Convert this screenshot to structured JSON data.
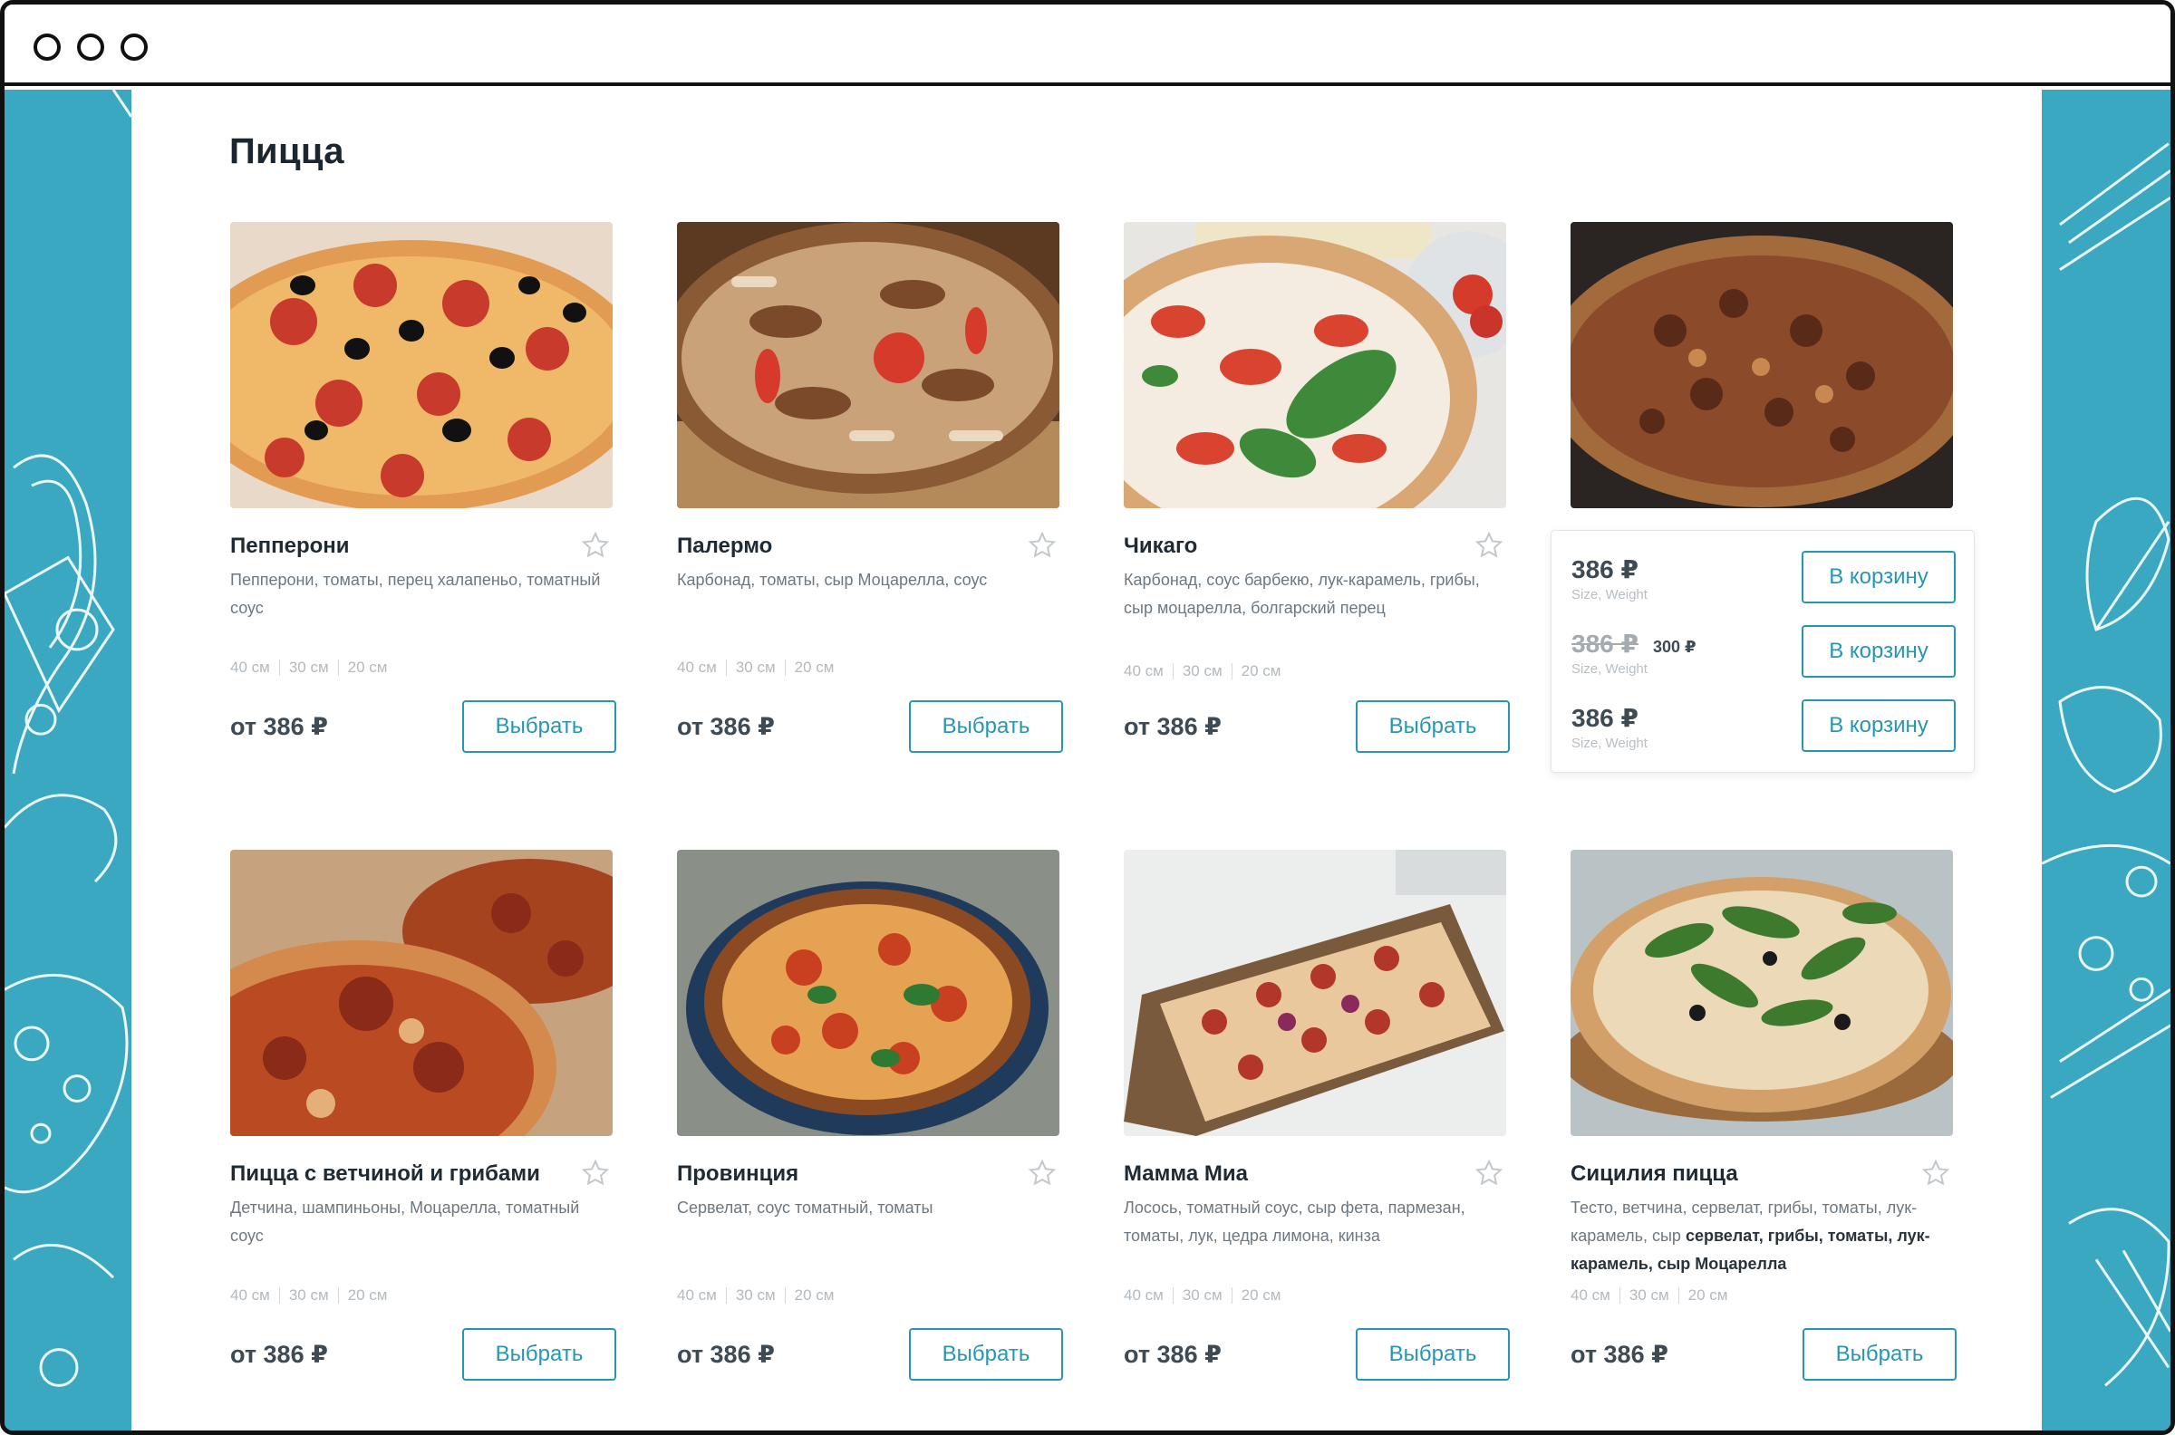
{
  "page": {
    "title": "Пицца"
  },
  "colors": {
    "accent": "#2697b2",
    "side_panel": "#3aa8c1",
    "text": "#1f2a33"
  },
  "products": [
    {
      "name": "Пепперони",
      "description": "Пепперони, томаты, перец халапеньо, томатный соус",
      "sizes": [
        "40 см",
        "30 см",
        "20 см"
      ],
      "price": "от 386 ₽",
      "button": "Выбрать"
    },
    {
      "name": "Палермо",
      "description": "Карбонад, томаты, сыр Моцарелла, соус",
      "sizes": [
        "40 см",
        "30 см",
        "20 см"
      ],
      "price": "от 386 ₽",
      "button": "Выбрать"
    },
    {
      "name": "Чикаго",
      "description": "Карбонад, соус барбекю, лук-карамель, грибы, сыр моцарелла, болгарский перец",
      "sizes": [
        "40 см",
        "30 см",
        "20 см"
      ],
      "price": "от 386 ₽",
      "button": "Выбрать"
    },
    {
      "name": "Пицца с ветчиной и грибами",
      "description": "Детчина, шампиньоны, Моцарелла, томатный соус",
      "sizes": [
        "40 см",
        "30 см",
        "20 см"
      ],
      "price": "от 386 ₽",
      "button": "Выбрать"
    },
    {
      "name": "Провинция",
      "description": "Сервелат, соус томатный, томаты",
      "sizes": [
        "40 см",
        "30 см",
        "20 см"
      ],
      "price": "от 386 ₽",
      "button": "Выбрать"
    },
    {
      "name": "Мамма Миа",
      "description": "Лосось, томатный соус, сыр фета, пармезан, томаты, лук, цедра лимона, кинза",
      "sizes": [
        "40 см",
        "30 см",
        "20 см"
      ],
      "price": "от 386 ₽",
      "button": "Выбрать"
    },
    {
      "name": "Сицилия пицца",
      "description_plain": "Тесто, ветчина, сервелат, грибы, томаты, лук-карамель, сыр ",
      "description_bold": "сервелат, грибы, томаты, лук-карамель, сыр Моцарелла",
      "sizes": [
        "40 см",
        "30 см",
        "20 см"
      ],
      "price": "от 386 ₽",
      "button": "Выбрать"
    }
  ],
  "popover": {
    "options": [
      {
        "price": "386 ₽",
        "sub": "Size, Weight",
        "button": "В корзину"
      },
      {
        "price": "386 ₽",
        "new_price": "300 ₽",
        "sub": "Size, Weight",
        "button": "В корзину"
      },
      {
        "price": "386 ₽",
        "sub": "Size, Weight",
        "button": "В корзину"
      }
    ]
  }
}
